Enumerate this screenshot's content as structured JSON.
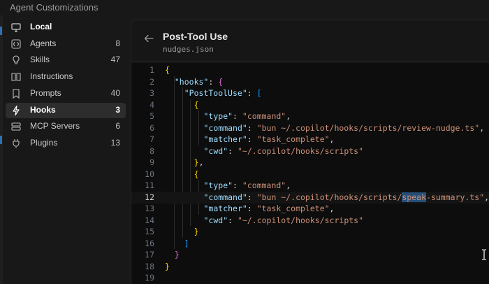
{
  "window": {
    "title": "Agent Customizations"
  },
  "sidebar": {
    "items": [
      {
        "label": "Local",
        "count": "",
        "icon": "monitor-icon",
        "header": true,
        "active": false
      },
      {
        "label": "Agents",
        "count": "8",
        "icon": "agents-icon",
        "header": false,
        "active": false
      },
      {
        "label": "Skills",
        "count": "47",
        "icon": "lightbulb-icon",
        "header": false,
        "active": false
      },
      {
        "label": "Instructions",
        "count": "",
        "icon": "book-icon",
        "header": false,
        "active": false
      },
      {
        "label": "Prompts",
        "count": "40",
        "icon": "bookmark-icon",
        "header": false,
        "active": false
      },
      {
        "label": "Hooks",
        "count": "3",
        "icon": "lightning-icon",
        "header": false,
        "active": true
      },
      {
        "label": "MCP Servers",
        "count": "6",
        "icon": "server-icon",
        "header": false,
        "active": false
      },
      {
        "label": "Plugins",
        "count": "13",
        "icon": "plug-icon",
        "header": false,
        "active": false
      }
    ]
  },
  "panel": {
    "title": "Post-Tool Use",
    "subtitle": "nudges.json"
  },
  "editor": {
    "current_line": 12,
    "line_numbers": [
      "1",
      "2",
      "3",
      "4",
      "5",
      "6",
      "7",
      "8",
      "9",
      "10",
      "11",
      "12",
      "13",
      "14",
      "15",
      "16",
      "17",
      "18",
      "19"
    ],
    "lines": [
      "{",
      "  \"hooks\": {",
      "    \"PostToolUse\": [",
      "      {",
      "        \"type\": \"command\",",
      "        \"command\": \"bun ~/.copilot/hooks/scripts/review-nudge.ts\",",
      "        \"matcher\": \"task_complete\",",
      "        \"cwd\": \"~/.copilot/hooks/scripts\"",
      "      },",
      "      {",
      "        \"type\": \"command\",",
      "        \"command\": \"bun ~/.copilot/hooks/scripts/speak-summary.ts\",",
      "        \"matcher\": \"task_complete\",",
      "        \"cwd\": \"~/.copilot/hooks/scripts\"",
      "      }",
      "    ]",
      "  }",
      "}",
      ""
    ]
  },
  "colors": {
    "key": "#9cdcfe",
    "string": "#ce9178",
    "bracket_level1": "#ffd700",
    "bracket_level2": "#da70d6",
    "bracket_level3": "#179fff",
    "selection": "#264f78",
    "accent": "#2f6fb5"
  }
}
